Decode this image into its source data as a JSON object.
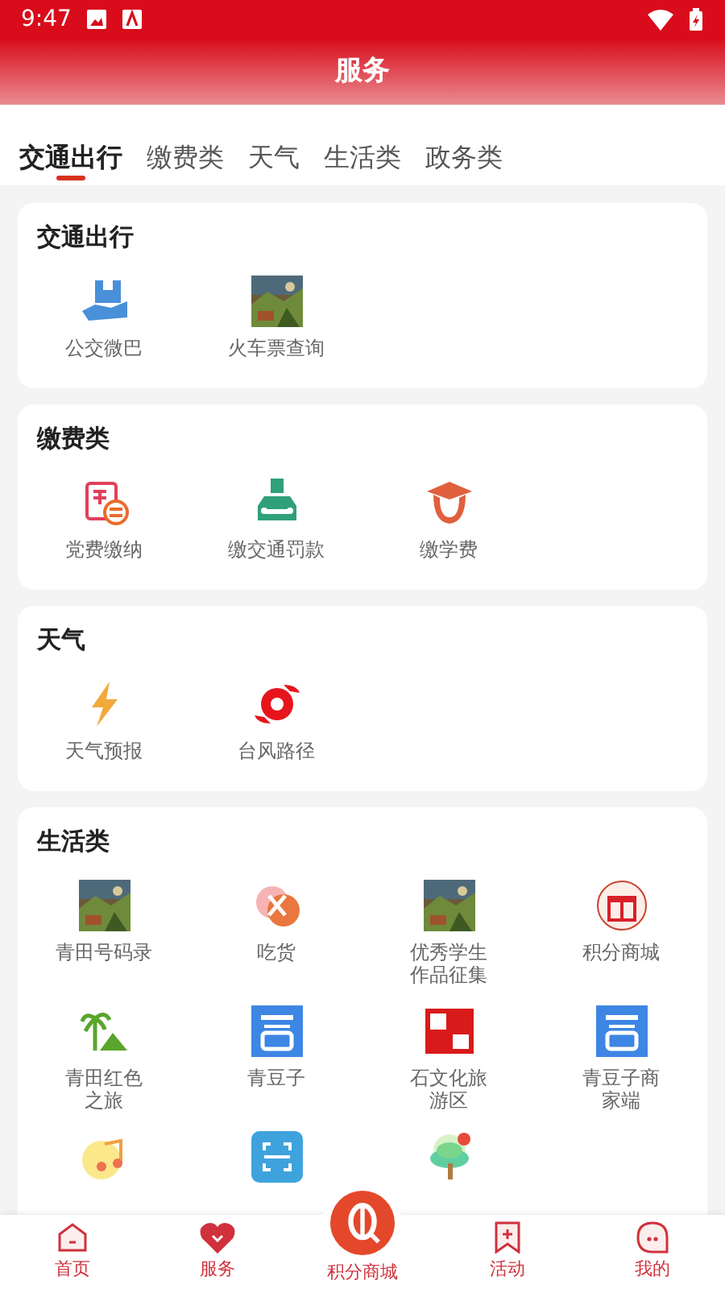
{
  "status_bar": {
    "time": "9:47"
  },
  "header": {
    "title": "服务"
  },
  "tabs": [
    {
      "label": "交通出行",
      "selected": true
    },
    {
      "label": "缴费类",
      "selected": false
    },
    {
      "label": "天气",
      "selected": false
    },
    {
      "label": "生活类",
      "selected": false
    },
    {
      "label": "政务类",
      "selected": false
    }
  ],
  "sections": [
    {
      "title": "交通出行",
      "items": [
        {
          "kind": "bus",
          "label": "公交微巴"
        },
        {
          "kind": "picture",
          "label": "火车票查询"
        }
      ]
    },
    {
      "title": "缴费类",
      "items": [
        {
          "kind": "receipt",
          "label": "党费缴纳"
        },
        {
          "kind": "car",
          "label": "缴交通罚款"
        },
        {
          "kind": "cap",
          "label": "缴学费"
        }
      ]
    },
    {
      "title": "天气",
      "items": [
        {
          "kind": "bolt",
          "label": "天气预报"
        },
        {
          "kind": "typhoon",
          "label": "台风路径"
        }
      ]
    },
    {
      "title": "生活类",
      "items": [
        {
          "kind": "picture",
          "label": "青田号码录"
        },
        {
          "kind": "food",
          "label": "吃货"
        },
        {
          "kind": "picture",
          "label": "优秀学生作品征集"
        },
        {
          "kind": "gift",
          "label": "积分商城"
        },
        {
          "kind": "palm",
          "label": "青田红色之旅"
        },
        {
          "kind": "bluetile",
          "label": "青豆子"
        },
        {
          "kind": "redseal",
          "label": "石文化旅游区"
        },
        {
          "kind": "bluetile",
          "label": "青豆子商家端"
        },
        {
          "kind": "music"
        },
        {
          "kind": "scan"
        },
        {
          "kind": "tree"
        }
      ]
    }
  ],
  "bottom_nav": [
    {
      "kind": "home",
      "label": "首页",
      "selected": false
    },
    {
      "kind": "heart",
      "label": "服务",
      "selected": true
    },
    {
      "kind": "center",
      "label": "积分商城",
      "selected": false
    },
    {
      "kind": "flag",
      "label": "活动",
      "selected": false
    },
    {
      "kind": "face",
      "label": "我的",
      "selected": false
    }
  ]
}
